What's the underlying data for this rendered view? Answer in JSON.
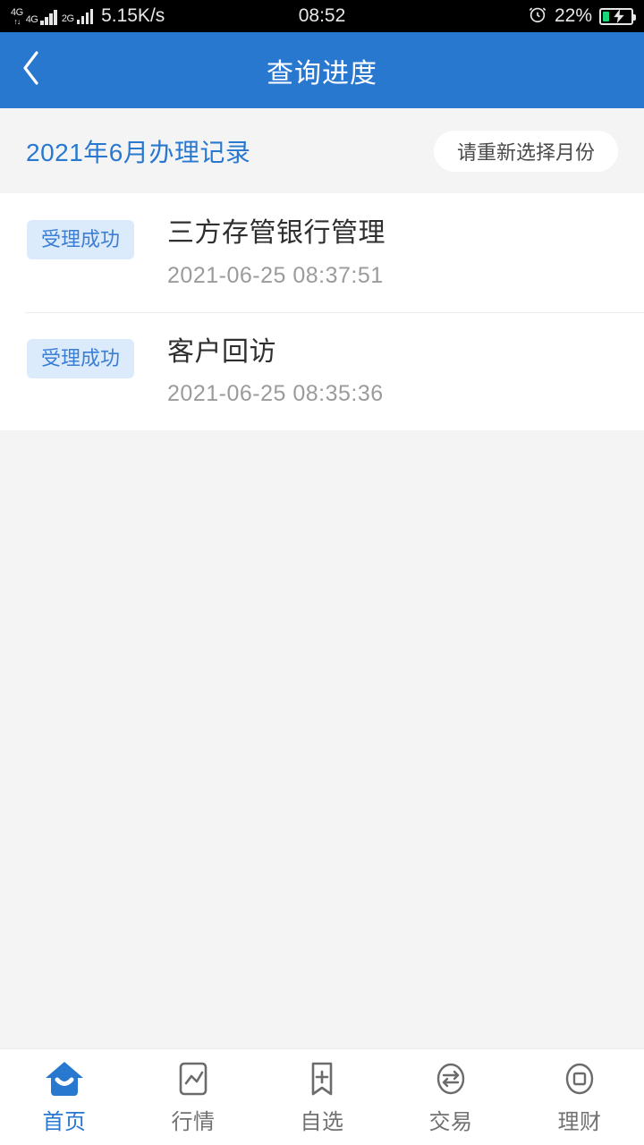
{
  "statusbar": {
    "network_labels": [
      "4G",
      "4G",
      "2G"
    ],
    "data_arrows": "↑↓",
    "speed": "5.15K/s",
    "clock": "08:52",
    "alarm_icon": "alarm-clock-icon",
    "battery_percent": "22%",
    "battery_level": 22,
    "battery_charging": true,
    "battery_color": "#17d97a"
  },
  "header": {
    "back_icon": "chevron-left-icon",
    "title": "查询进度",
    "background": "#2878d0"
  },
  "monthbar": {
    "title": "2021年6月办理记录",
    "title_color": "#2878d0",
    "reselect_label": "请重新选择月份"
  },
  "records": [
    {
      "status": "受理成功",
      "title": "三方存管银行管理",
      "time": "2021-06-25 08:37:51"
    },
    {
      "status": "受理成功",
      "title": "客户回访",
      "time": "2021-06-25 08:35:36"
    }
  ],
  "tabbar": {
    "active_color": "#2878d0",
    "items": [
      {
        "label": "首页",
        "icon": "home-icon",
        "active": true
      },
      {
        "label": "行情",
        "icon": "chart-icon",
        "active": false
      },
      {
        "label": "自选",
        "icon": "bookmark-plus-icon",
        "active": false
      },
      {
        "label": "交易",
        "icon": "exchange-arrows-icon",
        "active": false
      },
      {
        "label": "理财",
        "icon": "coin-circle-icon",
        "active": false
      }
    ]
  }
}
